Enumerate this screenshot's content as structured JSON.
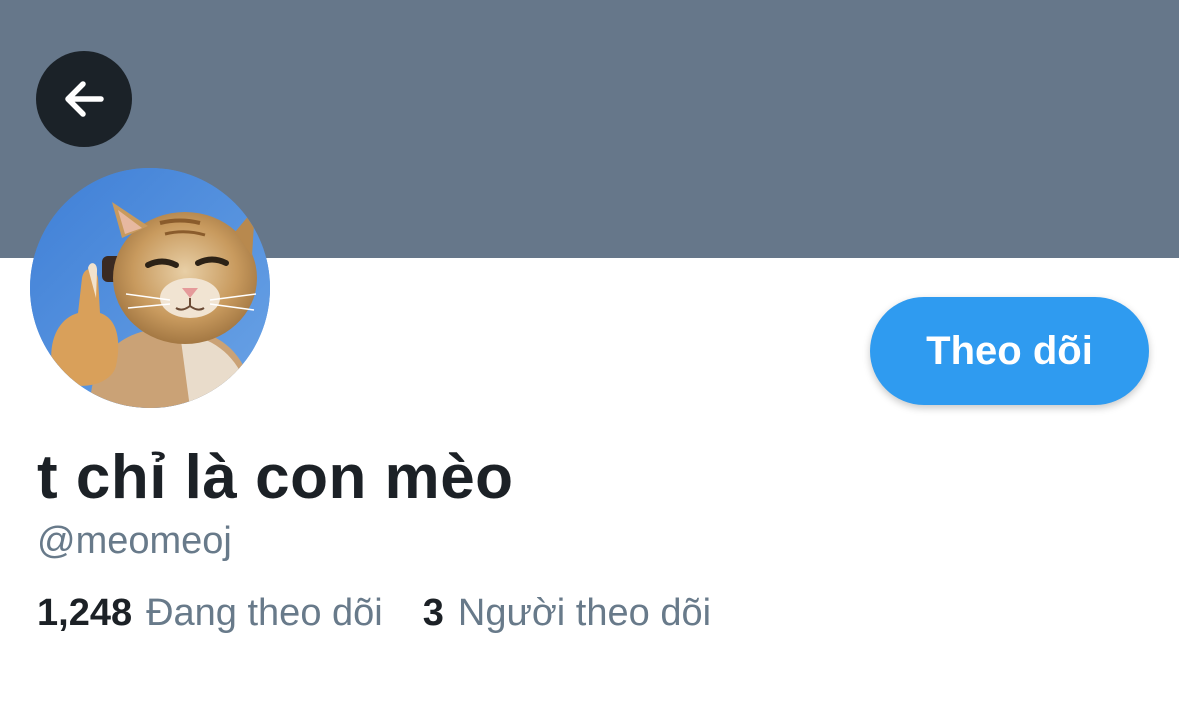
{
  "profile": {
    "display_name": "t chỉ là con mèo",
    "handle": "@meomeoj",
    "banner_color": "#66778a",
    "avatar": "cat-thumbs-up-photo"
  },
  "actions": {
    "back_icon": "arrow-left-icon",
    "follow_label": "Theo dõi",
    "follow_color": "#2f9bf0"
  },
  "stats": {
    "following_count": "1,248",
    "following_label": "Đang theo dõi",
    "followers_count": "3",
    "followers_label": "Người theo dõi"
  }
}
